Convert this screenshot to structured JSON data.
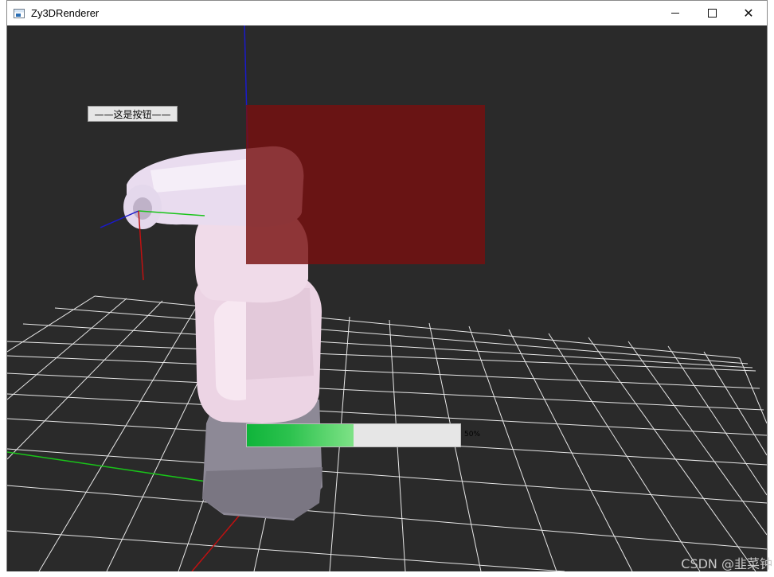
{
  "window": {
    "title": "Zy3DRenderer",
    "icon": "app-window-icon",
    "buttons": {
      "minimize": "minimize-icon",
      "maximize": "maximize-icon",
      "close": "✕"
    }
  },
  "scene": {
    "background": "#2a2a2a",
    "overlay_button_label": "——这是按钮——",
    "progress": {
      "value": 0.5,
      "label": "50%"
    },
    "panel_color": "#781010",
    "axis_colors": {
      "x": "#cc1111",
      "y": "#11cc11",
      "z": "#1111cc"
    },
    "grid_color": "#ffffff"
  },
  "watermark": "CSDN @韭菜钟"
}
